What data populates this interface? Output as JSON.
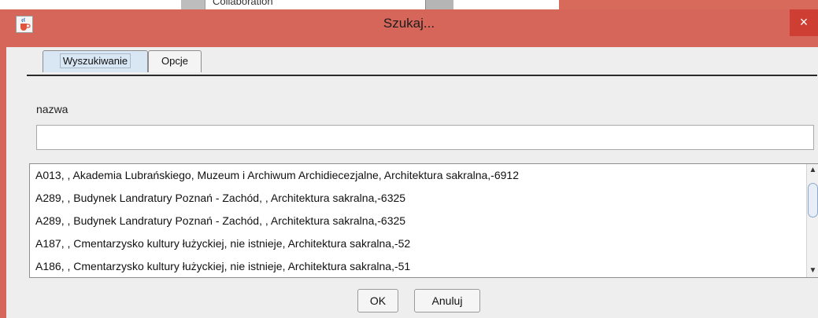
{
  "background": {
    "partial_label": "Collaboration"
  },
  "dialog": {
    "title": "Szukaj...",
    "close_glyph": "×",
    "icon": "java-cup-icon",
    "accent_color": "#d6665a"
  },
  "tabs": [
    {
      "label": "Wyszukiwanie",
      "active": true
    },
    {
      "label": "Opcje",
      "active": false
    }
  ],
  "search": {
    "label": "nazwa",
    "value": "",
    "placeholder": ""
  },
  "results": [
    "A013, , Akademia Lubrańskiego, Muzeum i Archiwum Archidiecezjalne, Architektura sakralna,-6912",
    "A289, , Budynek Landratury Poznań - Zachód, , Architektura sakralna,-6325",
    "A289, , Budynek Landratury Poznań - Zachód, , Architektura sakralna,-6325",
    "A187, , Cmentarzysko kultury łużyckiej, nie istnieje, Architektura sakralna,-52",
    "A186, , Cmentarzysko kultury łużyckiej, nie istnieje, Architektura sakralna,-51"
  ],
  "buttons": {
    "ok": "OK",
    "cancel": "Anuluj"
  }
}
